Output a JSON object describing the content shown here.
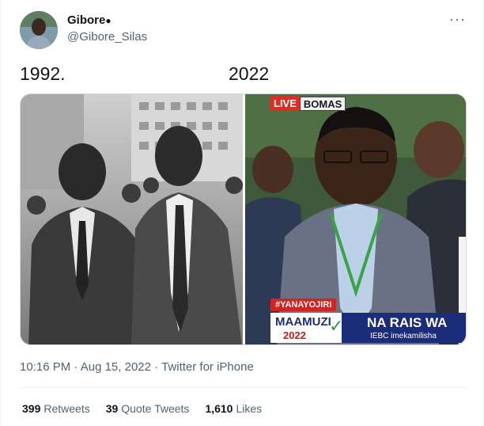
{
  "author": {
    "display_name": "Gibore",
    "verified_icon": "apple-icon",
    "handle": "@Gibore_Silas"
  },
  "more_icon": "more-dots-icon",
  "tweet": {
    "text_left": "1992.",
    "text_right": "2022"
  },
  "media": {
    "right_overlay": {
      "live_label": "LIVE",
      "location_label": "BOMAS",
      "hashtag": "#YANAYOJIRI",
      "logo_word": "MAAMUZI",
      "logo_year": "2022",
      "headline": "NA RAIS WA",
      "subline": "IEBC imekamilisha"
    }
  },
  "meta": {
    "time": "10:16 PM",
    "date": "Aug 15, 2022",
    "source": "Twitter for iPhone",
    "separator": "·"
  },
  "stats": {
    "retweets_count": "399",
    "retweets_label": "Retweets",
    "quotes_count": "39",
    "quotes_label": "Quote Tweets",
    "likes_count": "1,610",
    "likes_label": "Likes"
  },
  "colors": {
    "text_primary": "#0f1419",
    "text_secondary": "#536471",
    "border": "#cfd9de",
    "live_red": "#e32b21",
    "banner_blue": "#1b2c7a"
  }
}
